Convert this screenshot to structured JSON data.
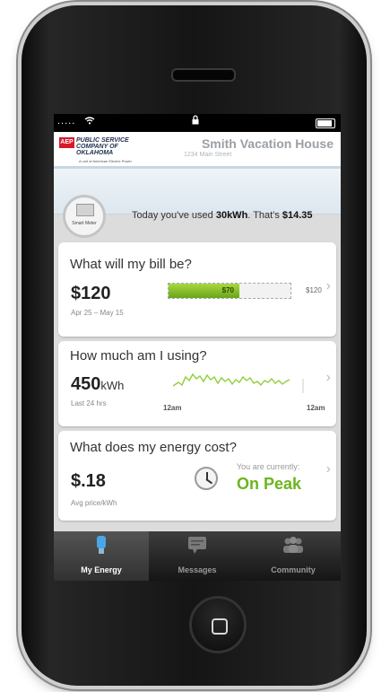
{
  "status_bar": {
    "signal": ".....",
    "wifi_icon": "wifi-icon",
    "lock_icon": "lock-icon",
    "battery_icon": "battery-icon"
  },
  "header": {
    "logo_badge": "AEP",
    "logo_lines": [
      "PUBLIC SERVICE",
      "COMPANY OF",
      "OKLAHOMA"
    ],
    "logo_subtitle": "A unit of American Electric Power",
    "house_name": "Smith Vacation House",
    "house_address": "1234 Main Street"
  },
  "usage_summary": {
    "meter_label": "Smart Meter",
    "prefix": "Today you've used ",
    "kwh": "30kWh",
    "mid": ". That's ",
    "cost": "$14.35"
  },
  "bill_card": {
    "title": "What will my bill be?",
    "amount": "$120",
    "period": "Apr 25 – May 15",
    "bar_label": "$70",
    "bar_max_label": "$120",
    "bar_fraction": 0.583
  },
  "usage_card": {
    "title": "How much am I using?",
    "value": "450",
    "unit": "kWh",
    "period": "Last 24 hrs",
    "tick_start": "12am",
    "tick_end": "12am"
  },
  "cost_card": {
    "title": "What does my energy cost?",
    "price": "$.18",
    "price_label": "Avg price/kWh",
    "currently_label": "You are currently:",
    "status": "On Peak"
  },
  "tabs": [
    {
      "label": "My Energy",
      "icon": "bulb-icon",
      "active": true
    },
    {
      "label": "Messages",
      "icon": "message-icon",
      "active": false
    },
    {
      "label": "Community",
      "icon": "community-icon",
      "active": false
    }
  ],
  "colors": {
    "accent_green": "#6bb51e",
    "brand_red": "#d7192a"
  }
}
